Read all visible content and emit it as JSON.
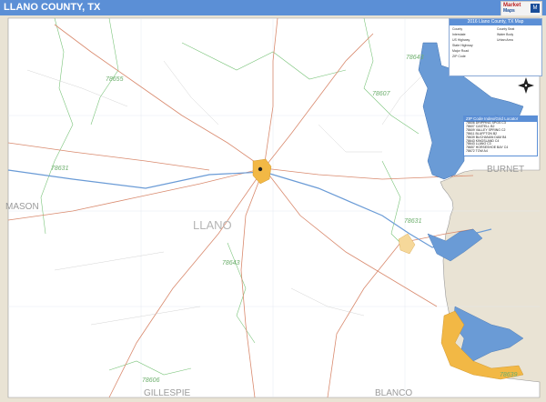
{
  "header": {
    "title": "LLANO COUNTY, TX"
  },
  "brand": {
    "line1": "Market",
    "line2": "Maps"
  },
  "map": {
    "county_label": "LLANO",
    "neighbors": {
      "mason": "MASON",
      "burnet": "BURNET",
      "gillespie": "GILLESPIE",
      "blanco": "BLANCO"
    },
    "zips": [
      "78655",
      "78607",
      "78631",
      "78631",
      "78643",
      "78643",
      "78643",
      "78606",
      "78639"
    ],
    "colors": {
      "water": "#6a9bd6",
      "urban": "#f2b845",
      "boundary_shade": "#e9e3d4",
      "road": "#d98a6e",
      "zip_line": "#7ac47a"
    }
  },
  "legend": {
    "title": "2016 Llano County, TX Map",
    "rows": [
      "County",
      "Interstate",
      "US Highway",
      "State Highway",
      "Major Road",
      "ZIP Code",
      "County Seat",
      "Water Body",
      "Urban Area"
    ]
  },
  "zip_panel": {
    "title": "ZIP Code Index/Grid Locator",
    "rows": [
      "78606  DRIPPING SPGS   C3",
      "78607  CASTELL         B2",
      "78609  VALLEY SPRING   C2",
      "78611  BLUFFTON        B2",
      "78639  BUCHANAN DAM    B4",
      "78643  KINGSLAND       C4",
      "78643  LLANO           C3",
      "78657  HORSESHOE BAY   C4",
      "78672  TOW             A4"
    ]
  }
}
